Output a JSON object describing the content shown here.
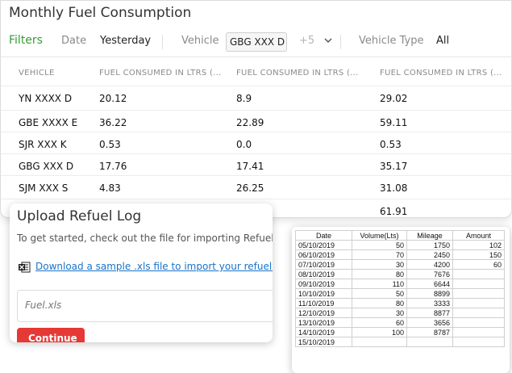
{
  "report": {
    "title": "Monthly Fuel Consumption",
    "filters": {
      "label": "Filters",
      "date_label": "Date",
      "date_value": "Yesterday",
      "vehicle_label": "Vehicle",
      "vehicle_chip": "GBG XXX D",
      "vehicle_more": "+5",
      "vehicle_type_label": "Vehicle Type",
      "vehicle_type_value": "All"
    },
    "columns": [
      "VEHICLE",
      "FUEL CONSUMED IN LTRS (...",
      "FUEL CONSUMED IN LTRS (...",
      "FUEL CONSUMED IN LTRS (..."
    ],
    "rows": [
      [
        "YN XXXX D",
        "20.12",
        "8.9",
        "29.02"
      ],
      [
        "GBE XXXX E",
        "36.22",
        "22.89",
        "59.11"
      ],
      [
        "SJR XXX K",
        "0.53",
        "0.0",
        "0.53"
      ],
      [
        "GBG XXX D",
        "17.76",
        "17.41",
        "35.17"
      ],
      [
        "SJM XXX S",
        "4.83",
        "26.25",
        "31.08"
      ],
      [
        "",
        "",
        "",
        "61.91"
      ]
    ]
  },
  "upload": {
    "title": "Upload Refuel Log",
    "description": "To get started, check out the file for importing Refuel",
    "download_link": "Download a sample .xls file to import your refuel data",
    "file_name": "Fuel.xls",
    "continue_label": "Continue"
  },
  "sheet": {
    "headers": [
      "Date",
      "Volume(Lts)",
      "Mileage",
      "Amount"
    ],
    "rows": [
      [
        "05/10/2019",
        "50",
        "1750",
        "102"
      ],
      [
        "06/10/2019",
        "70",
        "2450",
        "150"
      ],
      [
        "07/10/2019",
        "30",
        "4200",
        "60"
      ],
      [
        "08/10/2019",
        "80",
        "7676",
        ""
      ],
      [
        "09/10/2019",
        "110",
        "6644",
        ""
      ],
      [
        "10/10/2019",
        "50",
        "8899",
        ""
      ],
      [
        "11/10/2019",
        "80",
        "3333",
        ""
      ],
      [
        "12/10/2019",
        "30",
        "8877",
        ""
      ],
      [
        "13/10/2019",
        "60",
        "3656",
        ""
      ],
      [
        "14/10/2019",
        "100",
        "8787",
        ""
      ],
      [
        "15/10/2019",
        "",
        "",
        ""
      ]
    ]
  },
  "icons": {
    "chevron": "chevron-down-icon",
    "excel": "excel-file-icon"
  },
  "colors": {
    "filters_accent": "#3a9b3a",
    "link": "#1a73c8",
    "continue_button": "#e53935"
  }
}
